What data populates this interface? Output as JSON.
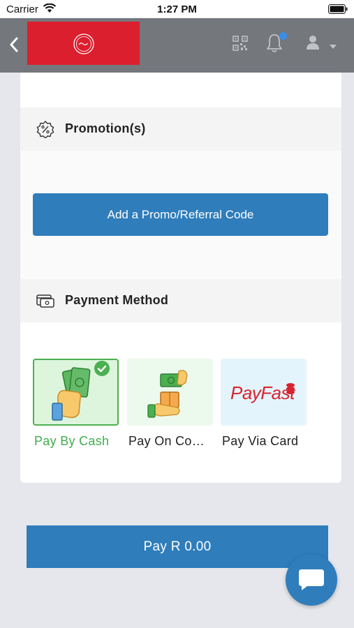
{
  "status_bar": {
    "carrier": "Carrier",
    "time": "1:27 PM"
  },
  "nav": {
    "back_icon": "chevron-left-icon",
    "logo": "brand-logo",
    "qr_icon": "qr-code-icon",
    "notification_icon": "bell-icon",
    "notification_dot_color": "#3a8ee6",
    "account_icon": "user-icon",
    "account_caret_icon": "caret-down-icon"
  },
  "promotions": {
    "title": "Promotion(s)",
    "icon": "discount-badge-icon",
    "add_code_label": "Add a Promo/Referral Code"
  },
  "payment": {
    "title": "Payment Method",
    "icon": "wallet-card-icon",
    "options": [
      {
        "label": "Pay By Cash",
        "icon": "cash-in-hand-icon",
        "selected": true
      },
      {
        "label": "Pay On Co…",
        "icon": "pay-on-collection-icon",
        "selected": false
      },
      {
        "label": "Pay Via Card",
        "icon": "payfast-logo",
        "logo_text": "PayFast",
        "selected": false
      }
    ]
  },
  "checkout": {
    "pay_label": "Pay R 0.00"
  },
  "chat": {
    "icon": "chat-bubble-icon"
  },
  "colors": {
    "primary": "#2f7dbb",
    "selected_green": "#4caf50",
    "nav_bg": "#74777c",
    "logo_red": "#dc1f2e"
  }
}
